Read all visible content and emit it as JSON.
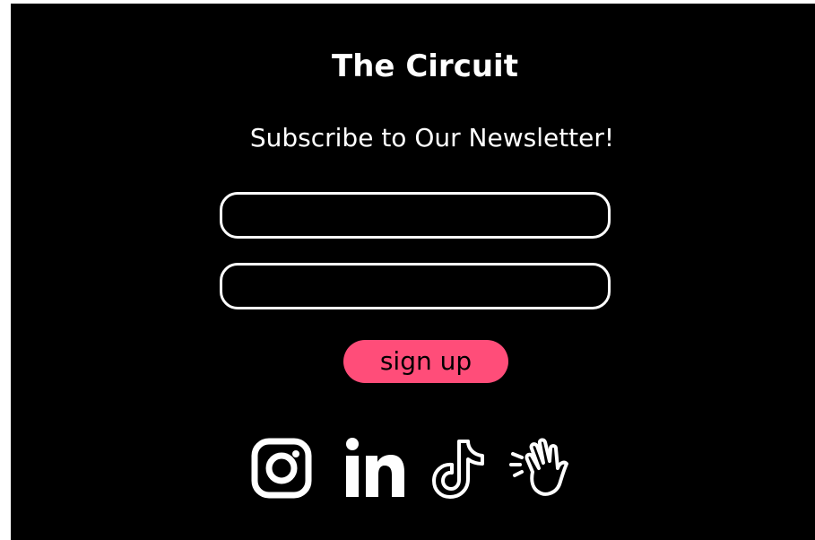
{
  "newsletter": {
    "title": "The Circuit",
    "subtitle": "Subscribe to Our Newsletter!",
    "fields": [
      {
        "value": "",
        "placeholder": ""
      },
      {
        "value": "",
        "placeholder": ""
      }
    ],
    "signup_label": "sign up"
  },
  "socials": [
    {
      "icon": "instagram-icon"
    },
    {
      "icon": "linkedin-icon"
    },
    {
      "icon": "tiktok-icon"
    },
    {
      "icon": "waving-hand-icon"
    }
  ],
  "colors": {
    "background": "#000000",
    "text": "#ffffff",
    "accent": "#ff4d79"
  }
}
